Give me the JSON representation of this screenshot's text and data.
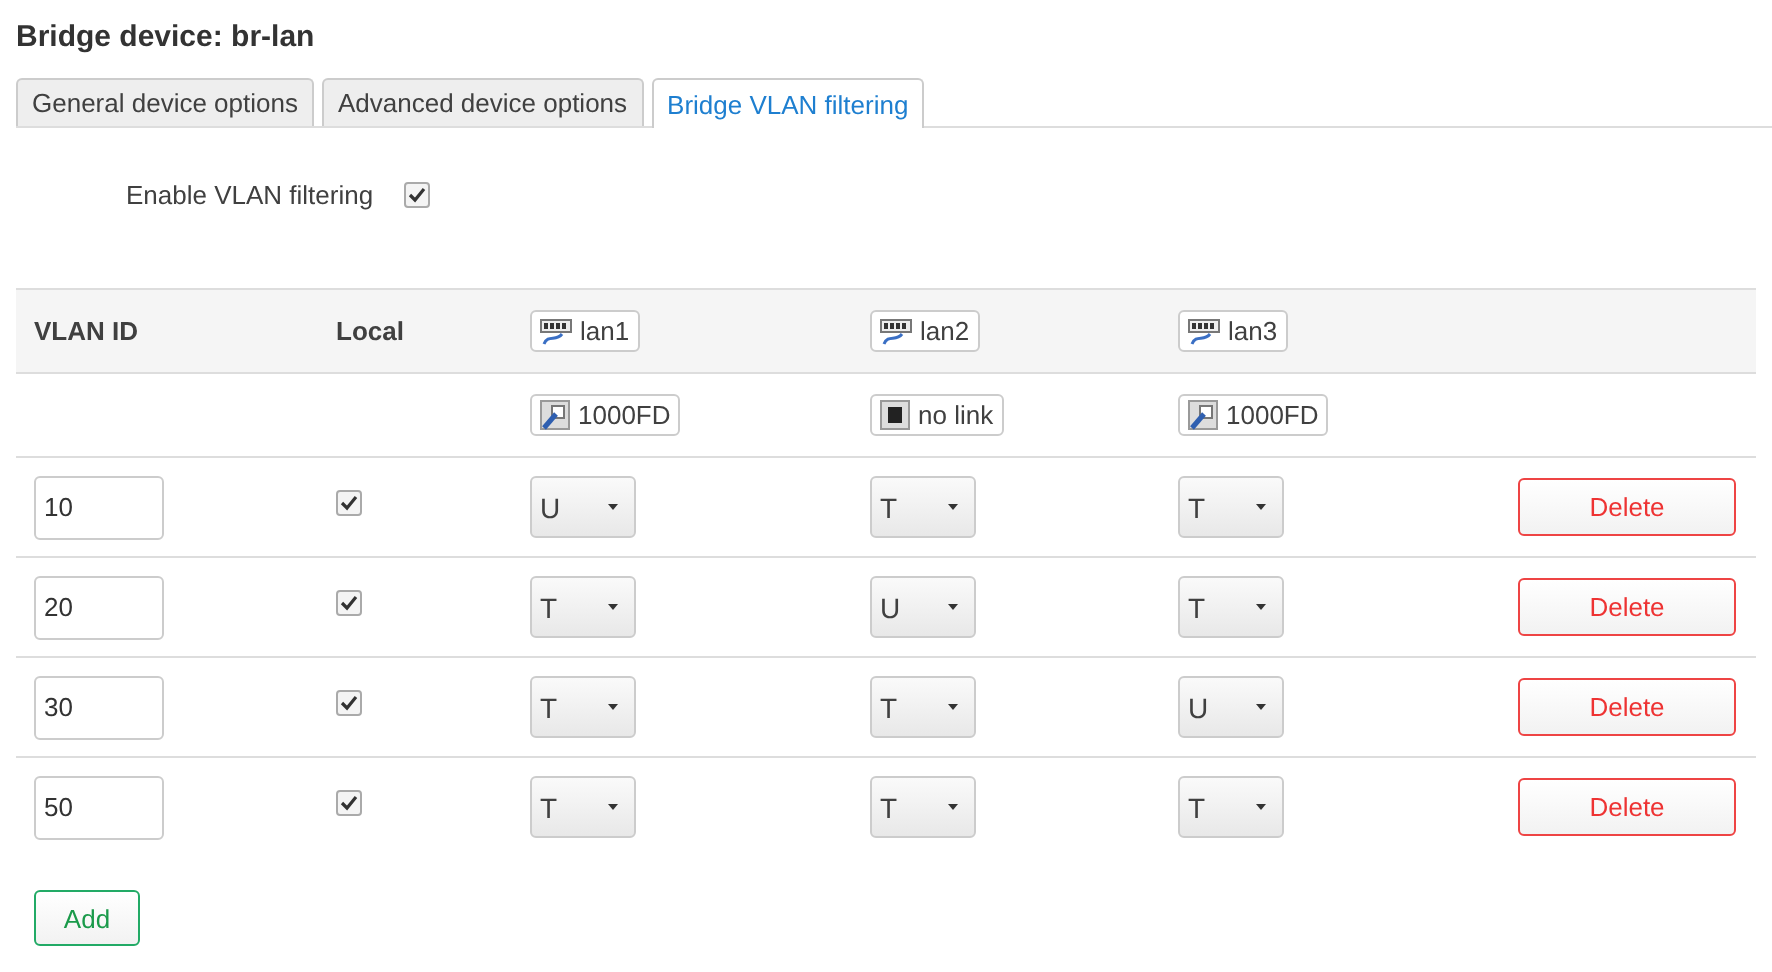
{
  "title": "Bridge device: br-lan",
  "tabs": [
    {
      "label": "General device options",
      "selected": false
    },
    {
      "label": "Advanced device options",
      "selected": false
    },
    {
      "label": "Bridge VLAN filtering",
      "selected": true
    }
  ],
  "enable_vlan_filtering": {
    "label": "Enable VLAN filtering",
    "checked": true
  },
  "table": {
    "columns": [
      "VLAN ID",
      "Local"
    ],
    "ports": [
      {
        "name": "lan1",
        "link": "1000FD",
        "kind": "up"
      },
      {
        "name": "lan2",
        "link": "no link",
        "kind": "down"
      },
      {
        "name": "lan3",
        "link": "1000FD",
        "kind": "up"
      }
    ],
    "rows": [
      {
        "vlan_id": "10",
        "local": true,
        "ports": [
          "U",
          "T",
          "T"
        ],
        "delete": "Delete"
      },
      {
        "vlan_id": "20",
        "local": true,
        "ports": [
          "T",
          "U",
          "T"
        ],
        "delete": "Delete"
      },
      {
        "vlan_id": "30",
        "local": true,
        "ports": [
          "T",
          "T",
          "U"
        ],
        "delete": "Delete"
      },
      {
        "vlan_id": "50",
        "local": true,
        "ports": [
          "T",
          "T",
          "T"
        ],
        "delete": "Delete"
      }
    ]
  },
  "add_button": "Add"
}
